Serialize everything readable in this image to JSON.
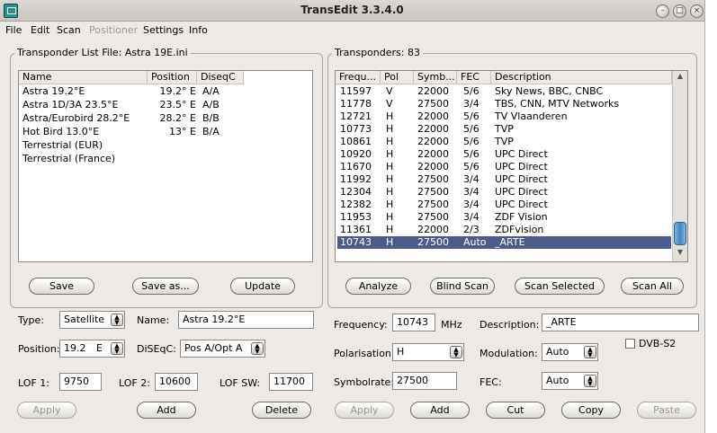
{
  "window": {
    "title": "TransEdit 3.3.4.0"
  },
  "menu": [
    "File",
    "Edit",
    "Scan",
    "Positioner",
    "Settings",
    "Info"
  ],
  "left": {
    "group_label": "Transponder List File:  Astra 19E.ini",
    "columns": [
      "Name",
      "Position",
      "DiseqC"
    ],
    "rows": [
      {
        "name": "Astra 19.2°E",
        "position": "19.2° E",
        "diseqc": "A/A"
      },
      {
        "name": "Astra 1D/3A 23.5°E",
        "position": "23.5° E",
        "diseqc": "A/B"
      },
      {
        "name": "Astra/Eurobird 28.2°E",
        "position": "28.2° E",
        "diseqc": "B/B"
      },
      {
        "name": "Hot Bird 13.0°E",
        "position": "13° E",
        "diseqc": "B/A"
      },
      {
        "name": "Terrestrial (EUR)",
        "position": "",
        "diseqc": ""
      },
      {
        "name": "Terrestrial (France)",
        "position": "",
        "diseqc": ""
      }
    ],
    "buttons": {
      "save": "Save",
      "save_as": "Save as...",
      "update": "Update"
    },
    "form": {
      "type_label": "Type:",
      "type_value": "Satellite",
      "name_label": "Name:",
      "name_value": "Astra 19.2°E",
      "position_label": "Position:",
      "position_value": "19.2",
      "position_dir": "E",
      "diseqc_label": "DiSEqC:",
      "diseqc_value": "Pos A/Opt A",
      "lof1_label": "LOF 1:",
      "lof1_value": "9750",
      "lof2_label": "LOF 2:",
      "lof2_value": "10600",
      "lofsw_label": "LOF SW:",
      "lofsw_value": "11700"
    },
    "bottom_buttons": {
      "apply": "Apply",
      "add": "Add",
      "delete": "Delete"
    }
  },
  "right": {
    "group_label": "Transponders: 83",
    "columns": [
      "Frequ...",
      "Pol",
      "Symb...",
      "FEC",
      "Description"
    ],
    "rows": [
      {
        "freq": "11597",
        "pol": "V",
        "sym": "22000",
        "fec": "5/6",
        "desc": "Sky News, BBC, CNBC"
      },
      {
        "freq": "11778",
        "pol": "V",
        "sym": "27500",
        "fec": "3/4",
        "desc": "TBS, CNN, MTV Networks"
      },
      {
        "freq": "12721",
        "pol": "H",
        "sym": "22000",
        "fec": "5/6",
        "desc": "TV Vlaanderen"
      },
      {
        "freq": "10773",
        "pol": "H",
        "sym": "22000",
        "fec": "5/6",
        "desc": "TVP"
      },
      {
        "freq": "10861",
        "pol": "H",
        "sym": "22000",
        "fec": "5/6",
        "desc": "TVP"
      },
      {
        "freq": "10920",
        "pol": "H",
        "sym": "22000",
        "fec": "5/6",
        "desc": "UPC Direct"
      },
      {
        "freq": "11670",
        "pol": "H",
        "sym": "22000",
        "fec": "5/6",
        "desc": "UPC Direct"
      },
      {
        "freq": "11992",
        "pol": "H",
        "sym": "27500",
        "fec": "3/4",
        "desc": "UPC Direct"
      },
      {
        "freq": "12304",
        "pol": "H",
        "sym": "27500",
        "fec": "3/4",
        "desc": "UPC Direct"
      },
      {
        "freq": "12382",
        "pol": "H",
        "sym": "27500",
        "fec": "3/4",
        "desc": "UPC Direct"
      },
      {
        "freq": "11953",
        "pol": "H",
        "sym": "27500",
        "fec": "3/4",
        "desc": "ZDF Vision"
      },
      {
        "freq": "11361",
        "pol": "H",
        "sym": "22000",
        "fec": "2/3",
        "desc": "ZDFvision"
      },
      {
        "freq": "10743",
        "pol": "H",
        "sym": "27500",
        "fec": "Auto",
        "desc": "_ARTE"
      }
    ],
    "selected_index": 12,
    "buttons": {
      "analyze": "Analyze",
      "blind_scan": "Blind Scan",
      "scan_selected": "Scan Selected",
      "scan_all": "Scan All"
    },
    "form": {
      "frequency_label": "Frequency:",
      "frequency_value": "10743",
      "frequency_unit": "MHz",
      "description_label": "Description:",
      "description_value": "_ARTE",
      "polarisation_label": "Polarisation:",
      "polarisation_value": "H",
      "modulation_label": "Modulation:",
      "modulation_value": "Auto",
      "dvbs2_label": "DVB-S2",
      "symbolrate_label": "Symbolrate:",
      "symbolrate_value": "27500",
      "fec_label": "FEC:",
      "fec_value": "Auto"
    },
    "bottom_buttons": {
      "apply": "Apply",
      "add": "Add",
      "cut": "Cut",
      "copy": "Copy",
      "paste": "Paste"
    }
  },
  "colors": {
    "selection": "#4c5a8c",
    "window_bg": "#ece9e6"
  }
}
